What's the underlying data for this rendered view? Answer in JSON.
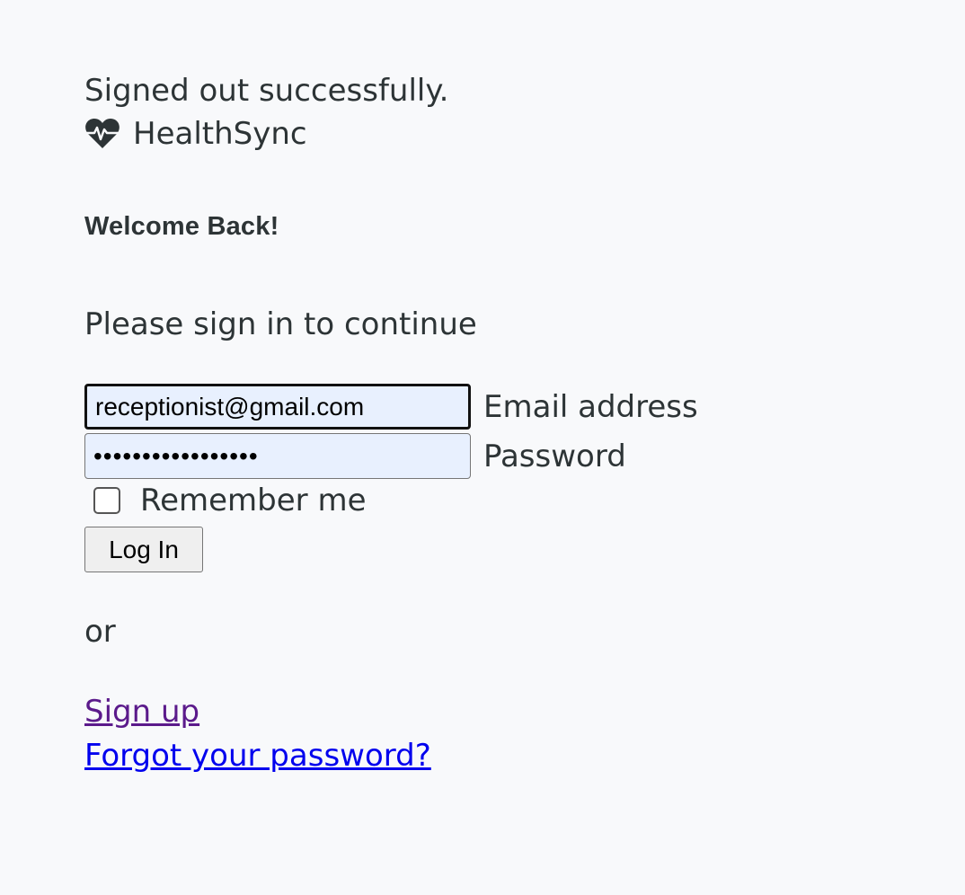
{
  "flash": "Signed out successfully.",
  "brand": {
    "name": "HealthSync",
    "icon": "heartbeat-icon"
  },
  "heading": "Welcome Back!",
  "prompt": "Please sign in to continue",
  "form": {
    "email_value": "receptionist@gmail.com",
    "email_label": "Email address",
    "password_value": "•••••••••••••••••",
    "password_label": "Password",
    "remember_label": "Remember me",
    "remember_checked": false,
    "submit_label": "Log In"
  },
  "or_text": "or",
  "links": {
    "signup": "Sign up",
    "forgot": "Forgot your password?"
  }
}
